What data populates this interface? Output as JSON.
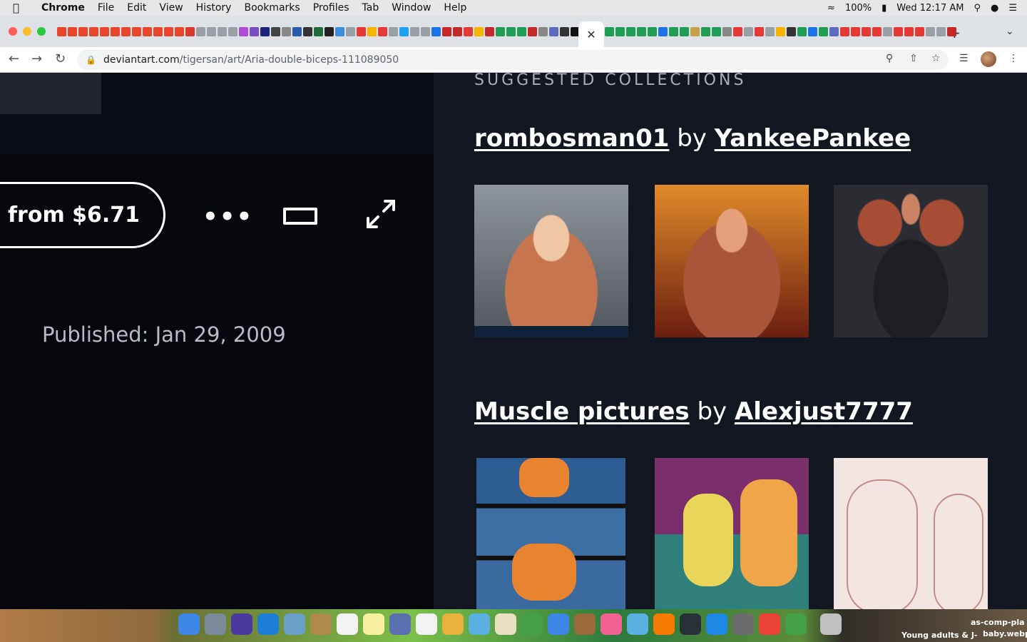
{
  "menubar": {
    "app": "Chrome",
    "items": [
      "File",
      "Edit",
      "View",
      "History",
      "Bookmarks",
      "Profiles",
      "Tab",
      "Window",
      "Help"
    ],
    "battery": "100%",
    "clock": "Wed 12:17 AM"
  },
  "browser": {
    "url_host": "deviantart.com",
    "url_path": "/tigersan/art/Aria-double-biceps-111089050"
  },
  "artwork": {
    "buy_label": "from $6.71",
    "more_label": "•••",
    "published": "Published: Jan 29, 2009"
  },
  "suggested": {
    "heading": "SUGGESTED COLLECTIONS",
    "collections": [
      {
        "title": "rombosman01",
        "by": "by",
        "author": "YankeePankee"
      },
      {
        "title": "Muscle pictures",
        "by": "by",
        "author": "Alexjust7777"
      }
    ]
  },
  "dock": {
    "label_1": "as-comp-pla",
    "label_2": "Young adults & J-",
    "label_3": "baby.webp"
  },
  "colors": {
    "left_bg": "#06070d",
    "right_bg": "#121621",
    "accent_white": "#ffffff"
  }
}
